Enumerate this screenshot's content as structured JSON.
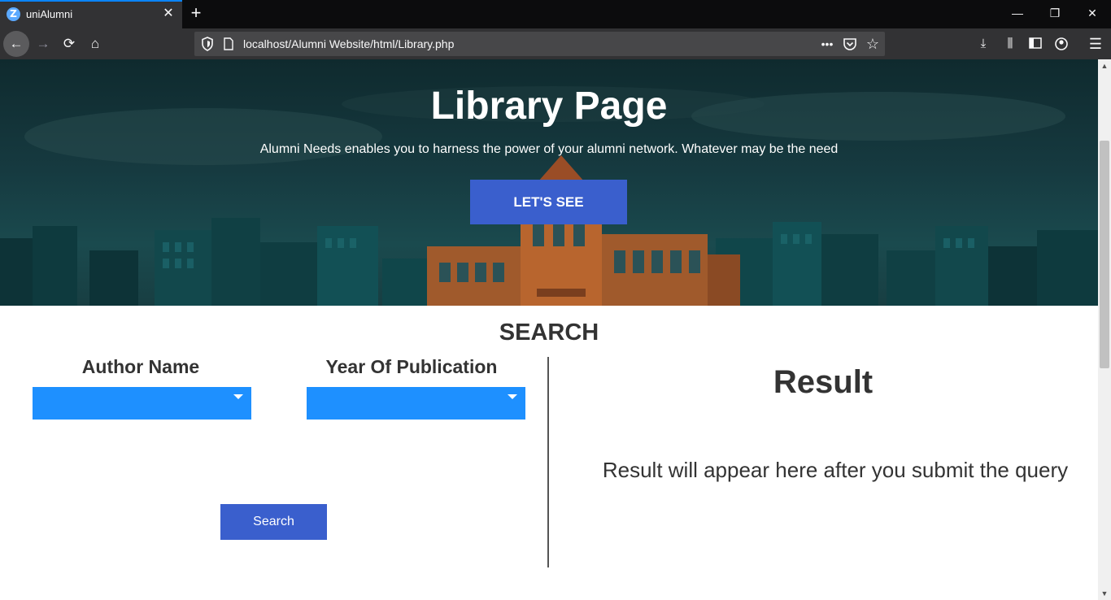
{
  "browser": {
    "tab_title": "uniAlumni",
    "tab_favicon_letter": "Z",
    "url": "localhost/Alumni Website/html/Library.php"
  },
  "hero": {
    "title": "Library Page",
    "subtitle": "Alumni Needs enables you to harness the power of your alumni network. Whatever may be the need",
    "button_label": "LET'S SEE"
  },
  "search": {
    "heading": "SEARCH",
    "author_label": "Author Name",
    "year_label": "Year Of Publication",
    "author_value": "",
    "year_value": "",
    "button_label": "Search"
  },
  "result": {
    "title": "Result",
    "message": "Result will appear here after you submit the query"
  },
  "colors": {
    "accent_button": "#3a5fcd",
    "select_bg": "#1e90ff",
    "hero_bg": "#163a40"
  }
}
